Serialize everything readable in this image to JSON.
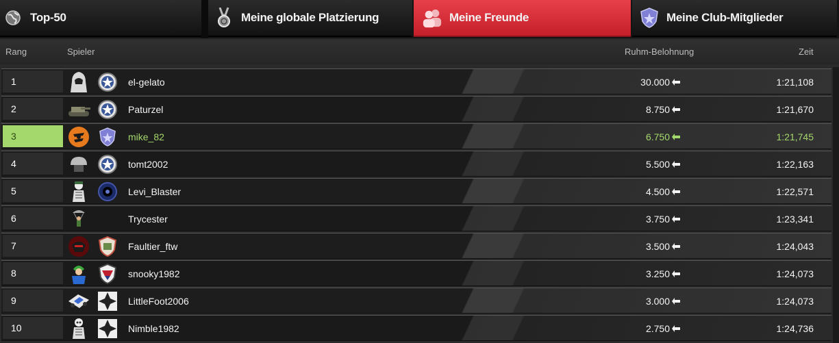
{
  "tabs": [
    {
      "label": "Top-50",
      "icon": "globe-icon",
      "active": false
    },
    {
      "label": "Meine globale Platzierung",
      "icon": "medal-icon",
      "active": false
    },
    {
      "label": "Meine Freunde",
      "icon": "friends-icon",
      "active": true
    },
    {
      "label": "Meine Club-Mitglieder",
      "icon": "club-shield-icon",
      "active": false
    }
  ],
  "columns": {
    "rank": "Rang",
    "player": "Spieler",
    "fame": "Ruhm-Belohnung",
    "time": "Zeit"
  },
  "colors": {
    "accent": "#d9323c",
    "highlight": "#a5d86c"
  },
  "rows": [
    {
      "rank": "1",
      "name": "el-gelato",
      "fame": "30.000",
      "time": "1:21,108",
      "avatar": "hooded-figure-avatar",
      "club": "star-badge-icon"
    },
    {
      "rank": "2",
      "name": "Paturzel",
      "fame": "8.750",
      "time": "1:21,670",
      "avatar": "tank-avatar",
      "club": "star-badge-icon"
    },
    {
      "rank": "3",
      "name": "mike_82",
      "fame": "6.750",
      "time": "1:21,745",
      "avatar": "orange-emblem-avatar",
      "club": "blue-shield-icon",
      "highlight": true
    },
    {
      "rank": "4",
      "name": "tomt2002",
      "fame": "5.500",
      "time": "1:22,163",
      "avatar": "helmet-avatar",
      "club": "star-badge-icon"
    },
    {
      "rank": "5",
      "name": "Levi_Blaster",
      "fame": "4.500",
      "time": "1:22,571",
      "avatar": "skeleton-soldier-avatar",
      "club": "eye-badge-icon"
    },
    {
      "rank": "6",
      "name": "Trycester",
      "fame": "3.750",
      "time": "1:23,341",
      "avatar": "parachute-avatar",
      "club": ""
    },
    {
      "rank": "7",
      "name": "Faultier_ftw",
      "fame": "3.500",
      "time": "1:24,043",
      "avatar": "red-mask-avatar",
      "club": "crest-badge-icon"
    },
    {
      "rank": "8",
      "name": "snooky1982",
      "fame": "3.250",
      "time": "1:24,073",
      "avatar": "green-hair-avatar",
      "club": "shield-crest-icon"
    },
    {
      "rank": "9",
      "name": "LittleFoot2006",
      "fame": "3.000",
      "time": "1:24,073",
      "avatar": "vehicle-avatar",
      "club": "iron-cross-icon"
    },
    {
      "rank": "10",
      "name": "Nimble1982",
      "fame": "2.750",
      "time": "1:24,736",
      "avatar": "skeleton-avatar",
      "club": "iron-cross-icon"
    }
  ]
}
